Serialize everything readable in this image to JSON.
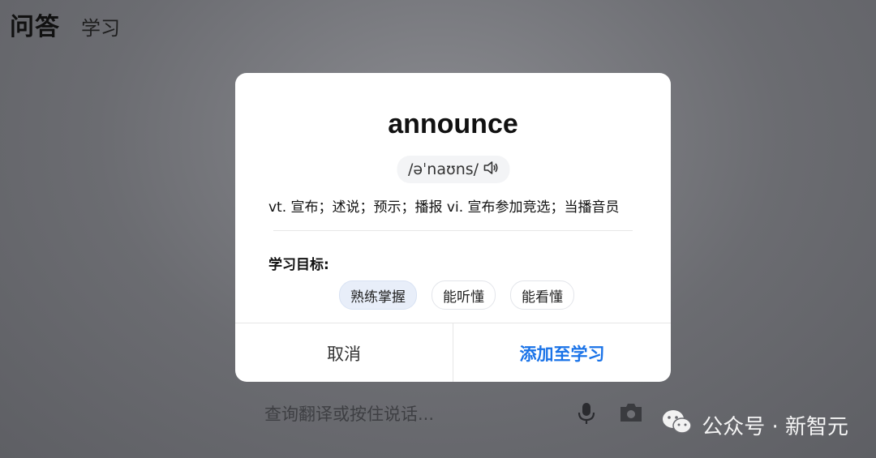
{
  "tabs": {
    "active": "问答",
    "inactive": "学习"
  },
  "input": {
    "placeholder": "查询翻译或按住说话..."
  },
  "watermark": {
    "text": "公众号 · 新智元"
  },
  "dialog": {
    "word": "announce",
    "phonetic": "/əˈnaʊns/",
    "definition": "vt. 宣布；述说；预示；播报 vi. 宣布参加竞选；当播音员",
    "goal_label": "学习目标:",
    "goals": [
      "熟练掌握",
      "能听懂",
      "能看懂"
    ],
    "selected_goal": "熟练掌握",
    "cancel_label": "取消",
    "add_label": "添加至学习"
  },
  "colors": {
    "accent": "#1a73e8",
    "selected_chip": "#e8eef9"
  },
  "icons": [
    "speaker-icon",
    "mic-icon",
    "camera-icon",
    "wechat-icon"
  ]
}
